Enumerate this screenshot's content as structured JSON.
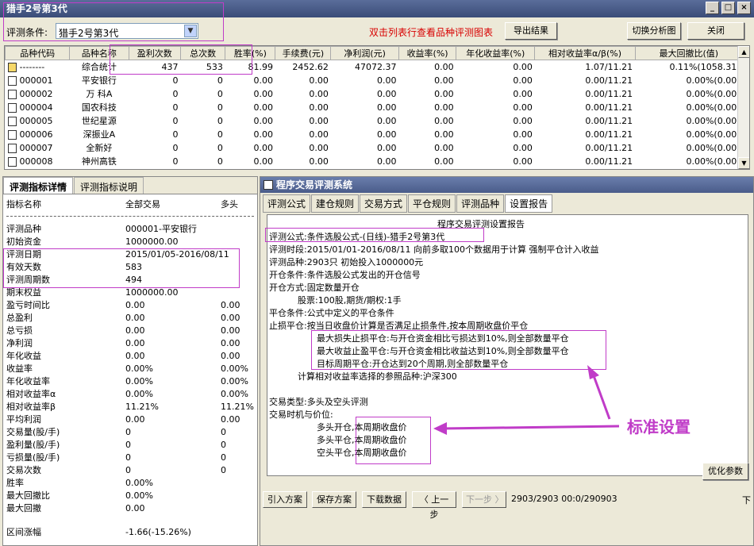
{
  "window": {
    "title": "猎手2号第3代",
    "btn_min": "_",
    "btn_max": "□",
    "btn_close": "×"
  },
  "toolbar": {
    "condition_label": "评测条件:",
    "condition_value": "猎手2号第3代",
    "hint": "双击列表行查看品种评测图表",
    "export_label": "导出结果",
    "switch_label": "切换分析图",
    "close_label": "关闭"
  },
  "grid": {
    "headers": [
      "品种代码",
      "品种名称",
      "盈利次数",
      "总次数",
      "胜率(%)",
      "手续费(元)",
      "净利润(元)",
      "收益率(%)",
      "年化收益率(%)",
      "相对收益率α/β(%)",
      "最大回撤比(值)"
    ],
    "rows": [
      [
        "--------",
        "综合统计",
        "437",
        "533",
        "81.99",
        "2452.62",
        "47072.37",
        "0.00",
        "0.00",
        "1.07/11.21",
        "0.11%(1058.31)"
      ],
      [
        "000001",
        "平安银行",
        "0",
        "0",
        "0.00",
        "0.00",
        "0.00",
        "0.00",
        "0.00",
        "0.00/11.21",
        "0.00%(0.00)"
      ],
      [
        "000002",
        "万 科A",
        "0",
        "0",
        "0.00",
        "0.00",
        "0.00",
        "0.00",
        "0.00",
        "0.00/11.21",
        "0.00%(0.00)"
      ],
      [
        "000004",
        "国农科技",
        "0",
        "0",
        "0.00",
        "0.00",
        "0.00",
        "0.00",
        "0.00",
        "0.00/11.21",
        "0.00%(0.00)"
      ],
      [
        "000005",
        "世纪星源",
        "0",
        "0",
        "0.00",
        "0.00",
        "0.00",
        "0.00",
        "0.00",
        "0.00/11.21",
        "0.00%(0.00)"
      ],
      [
        "000006",
        "深振业A",
        "0",
        "0",
        "0.00",
        "0.00",
        "0.00",
        "0.00",
        "0.00",
        "0.00/11.21",
        "0.00%(0.00)"
      ],
      [
        "000007",
        "全新好",
        "0",
        "0",
        "0.00",
        "0.00",
        "0.00",
        "0.00",
        "0.00",
        "0.00/11.21",
        "0.00%(0.00)"
      ],
      [
        "000008",
        "神州高铁",
        "0",
        "0",
        "0.00",
        "0.00",
        "0.00",
        "0.00",
        "0.00",
        "0.00/11.21",
        "0.00%(0.00)"
      ]
    ]
  },
  "left_panel": {
    "tabs": [
      "评测指标详情",
      "评测指标说明"
    ],
    "col_headers": [
      "指标名称",
      "全部交易",
      "多头"
    ],
    "rows": [
      [
        "评测品种",
        "000001-平安银行",
        ""
      ],
      [
        "初始资金",
        "1000000.00",
        ""
      ],
      [
        "评测日期",
        "2015/01/05-2016/08/11",
        ""
      ],
      [
        "有效天数",
        "583",
        ""
      ],
      [
        "评测周期数",
        "494",
        ""
      ],
      [
        "期末权益",
        "1000000.00",
        ""
      ],
      [
        "盈亏时间比",
        "0.00",
        "0.00"
      ],
      [
        "总盈利",
        "0.00",
        "0.00"
      ],
      [
        "总亏损",
        "0.00",
        "0.00"
      ],
      [
        "净利润",
        "0.00",
        "0.00"
      ],
      [
        "年化收益",
        "0.00",
        "0.00"
      ],
      [
        "收益率",
        "0.00%",
        "0.00%"
      ],
      [
        "年化收益率",
        "0.00%",
        "0.00%"
      ],
      [
        "相对收益率α",
        "0.00%",
        "0.00%"
      ],
      [
        "相对收益率β",
        "11.21%",
        "11.21%"
      ],
      [
        "平均利润",
        "0.00",
        "0.00"
      ],
      [
        "交易量(股/手)",
        "0",
        "0"
      ],
      [
        "盈利量(股/手)",
        "0",
        "0"
      ],
      [
        "亏损量(股/手)",
        "0",
        "0"
      ],
      [
        "交易次数",
        "0",
        "0"
      ],
      [
        "胜率",
        "0.00%",
        ""
      ],
      [
        "最大回撤比",
        "0.00%",
        ""
      ],
      [
        "最大回撤",
        "0.00",
        ""
      ],
      [
        "区间涨幅",
        "-1.66(-15.26%)",
        ""
      ]
    ]
  },
  "right_panel": {
    "title": "程序交易评测系统",
    "tabs": [
      "评测公式",
      "建仓规则",
      "交易方式",
      "平仓规则",
      "评测品种",
      "设置报告"
    ],
    "report_title": "程序交易评测设置报告",
    "lines": [
      "评测公式:条件选股公式-(日线)-猎手2号第3代",
      "评测时段:2015/01/01-2016/08/11 向前多取100个数据用于计算 强制平仓计入收益",
      "评测品种:2903只 初始投入1000000元",
      "开仓条件:条件选股公式发出的开仓信号",
      "开仓方式:固定数量开仓",
      "股票:100股,期货/期权:1手",
      "平仓条件:公式中定义的平仓条件",
      "止损平仓:按当日收盘价计算是否满足止损条件,按本周期收盘价平仓",
      "最大损失止损平仓:与开仓资金相比亏损达到10%,则全部数量平仓",
      "最大收益止盈平仓:与开仓资金相比收益达到10%,则全部数量平仓",
      "目标周期平仓:开仓达到20个周期,则全部数量平仓",
      "计算相对收益率选择的参照品种:沪深300",
      "交易类型:多头及空头评测",
      "交易时机与价位:",
      "多头开仓,本周期收盘价",
      "多头平仓,本周期收盘价",
      "空头平仓,本周期收盘价"
    ],
    "annotation": "标准设置",
    "optimize_label": "优化参数",
    "buttons": [
      "引入方案",
      "保存方案",
      "下载数据",
      "〈 上一步",
      "下一步 〉"
    ],
    "status": "2903/2903 00:0/290903",
    "edge_label": "下"
  }
}
